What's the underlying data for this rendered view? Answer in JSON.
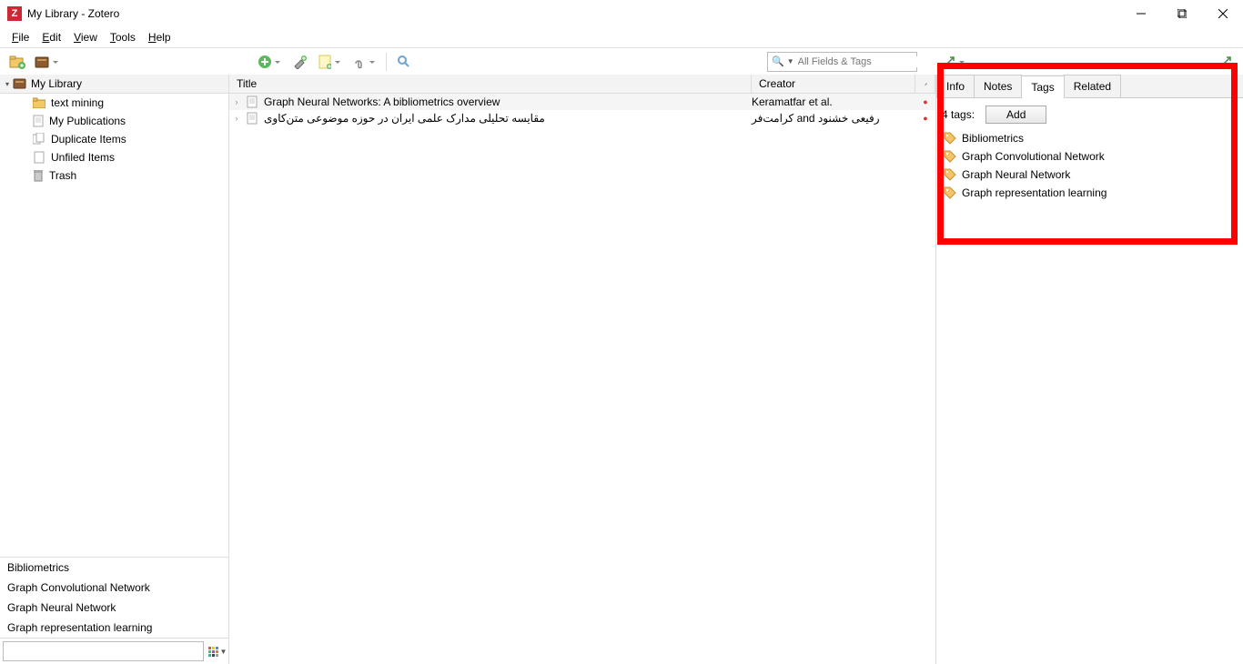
{
  "window": {
    "title": "My Library - Zotero"
  },
  "menu": {
    "file": "File",
    "edit": "Edit",
    "view": "View",
    "tools": "Tools",
    "help": "Help"
  },
  "search": {
    "placeholder": "All Fields & Tags"
  },
  "collections": {
    "root": "My Library",
    "items": [
      {
        "label": "text mining",
        "icon": "folder"
      },
      {
        "label": "My Publications",
        "icon": "page"
      },
      {
        "label": "Duplicate Items",
        "icon": "dup"
      },
      {
        "label": "Unfiled Items",
        "icon": "unfiled"
      },
      {
        "label": "Trash",
        "icon": "trash"
      }
    ]
  },
  "tag_filter": [
    "Bibliometrics",
    "Graph Convolutional Network",
    "Graph Neural Network",
    "Graph representation learning"
  ],
  "columns": {
    "title": "Title",
    "creator": "Creator"
  },
  "items": [
    {
      "title": "Graph Neural Networks: A bibliometrics overview",
      "creator": "Keramatfar et al.",
      "pdf": true
    },
    {
      "title": "مقایسه تحلیلی مدارک علمی ایران در حوزه موضوعی متن‌کاوی",
      "creator": "کرامت‌فر and رفیعی خشنود",
      "pdf": true
    }
  ],
  "detail": {
    "tabs": {
      "info": "Info",
      "notes": "Notes",
      "tags": "Tags",
      "related": "Related"
    },
    "active": "tags",
    "tag_count_label": "4 tags:",
    "add_label": "Add",
    "tags": [
      "Bibliometrics",
      "Graph Convolutional Network",
      "Graph Neural Network",
      "Graph representation learning"
    ]
  }
}
